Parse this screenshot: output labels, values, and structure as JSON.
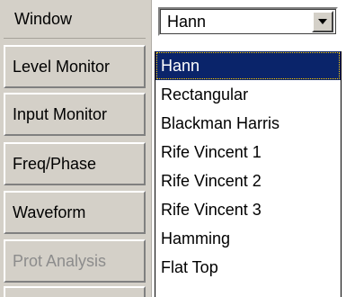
{
  "sidebar": {
    "items": [
      {
        "label": "Window",
        "enabled": true
      },
      {
        "label": "Level Monitor",
        "enabled": true
      },
      {
        "label": "Input Monitor",
        "enabled": true
      },
      {
        "label": "Freq/Phase",
        "enabled": true
      },
      {
        "label": "Waveform",
        "enabled": true
      },
      {
        "label": "Prot Analysis",
        "enabled": false
      }
    ]
  },
  "window_select": {
    "value": "Hann",
    "button_icon": "chevron-down-icon"
  },
  "dropdown": {
    "selected_index": 0,
    "options": [
      "Hann",
      "Rectangular",
      "Blackman Harris",
      "Rife Vincent 1",
      "Rife Vincent 2",
      "Rife Vincent 3",
      "Hamming",
      "Flat Top"
    ]
  },
  "colors": {
    "panel": "#d4d0c8",
    "selection": "#0a246a",
    "disabled_text": "#8c8c8c"
  }
}
